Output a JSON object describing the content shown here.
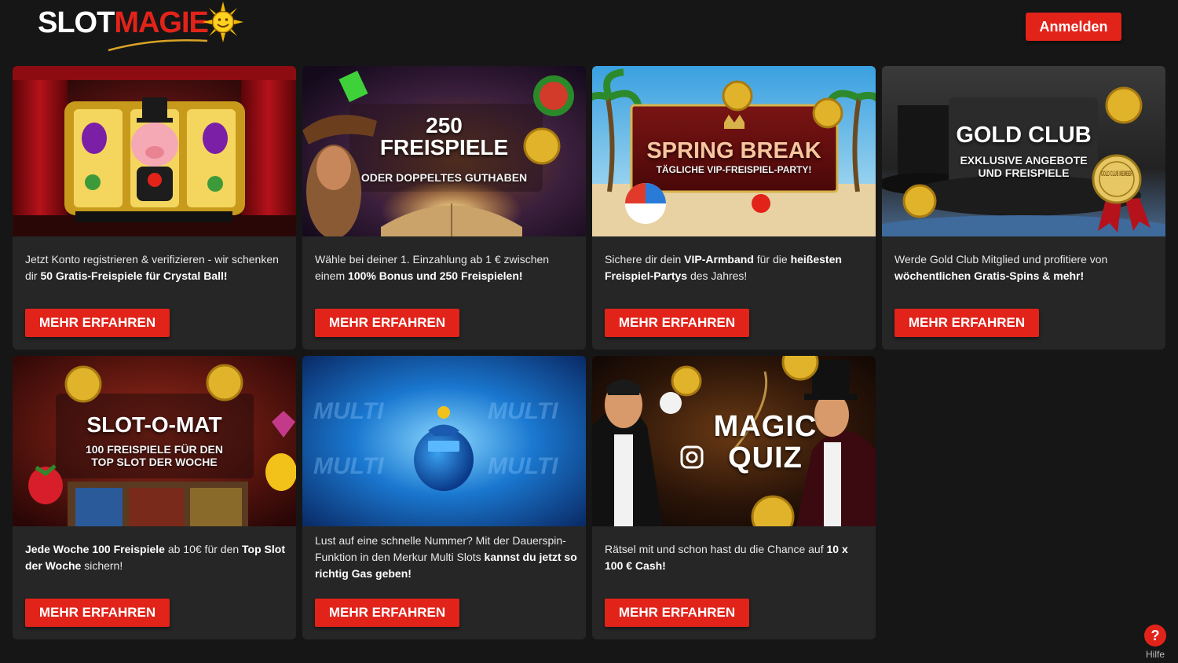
{
  "header": {
    "logo_part1": "SLOT",
    "logo_part2": "MAGIE",
    "login_label": "Anmelden"
  },
  "cards": [
    {
      "banner_icon": "lucky-pig-slot-icon",
      "banner_title": "",
      "banner_sub": "",
      "desc_html": "Jetzt Konto registrieren & verifizieren  - wir schenken dir <b>50 Gratis-Freispiele für Crystal Ball!</b>",
      "button": "MEHR ERFAHREN"
    },
    {
      "banner_icon": "cowboy-book-icon",
      "banner_title": "250\nFREISPIELE",
      "banner_sub": "ODER DOPPELTES GUTHABEN",
      "desc_html": "Wähle bei deiner 1. Einzahlung ab 1 € zwischen einem <b>100% Bonus und 250 Freispielen!</b>",
      "button": "MEHR ERFAHREN"
    },
    {
      "banner_icon": "beach-ball-icon",
      "banner_title": "SPRING BREAK",
      "banner_sub": "TÄGLICHE VIP-FREISPIEL-PARTY!",
      "desc_html": "Sichere dir dein <b>VIP-Armband</b> für die <b>heißesten Freispiel-Partys</b> des Jahres!",
      "button": "MEHR ERFAHREN"
    },
    {
      "banner_icon": "top-hat-icon",
      "banner_title": "GOLD CLUB",
      "banner_sub": "EXKLUSIVE ANGEBOTE\nUND FREISPIELE",
      "badge": "GOLD CLUB MEMBER",
      "desc_html": "Werde Gold Club Mitglied und profitiere von <b>wöchentlichen Gratis-Spins & mehr!</b>",
      "button": "MEHR ERFAHREN"
    },
    {
      "banner_icon": "slot-machine-icon",
      "banner_title": "SLOT-O-MAT",
      "banner_sub": "100 FREISPIELE FÜR DEN\nTOP SLOT DER WOCHE",
      "desc_html": "<b>Jede Woche 100 Freispiele</b> ab 10€ für den <b>Top Slot der Woche</b> sichern!",
      "button": "MEHR ERFAHREN"
    },
    {
      "banner_icon": "money-bag-icon",
      "banner_title": "",
      "banner_sub": "",
      "bg_word": "MULTI",
      "desc_html": "Lust auf eine schnelle Nummer? Mit der Dauerspin-Funktion in den Merkur Multi Slots <b>kannst du jetzt so richtig Gas geben!</b>",
      "button": "MEHR ERFAHREN"
    },
    {
      "banner_icon": "magician-icon",
      "banner_title": "MAGIC\nQUIZ",
      "banner_sub": "",
      "desc_html": "Rätsel mit und schon hast du die Chance auf <b>10 x 100 € Cash!</b>",
      "button": "MEHR ERFAHREN"
    }
  ],
  "help": {
    "glyph": "?",
    "label": "Hilfe"
  },
  "colors": {
    "accent": "#e2231a",
    "background": "#161616",
    "card": "#262626"
  }
}
